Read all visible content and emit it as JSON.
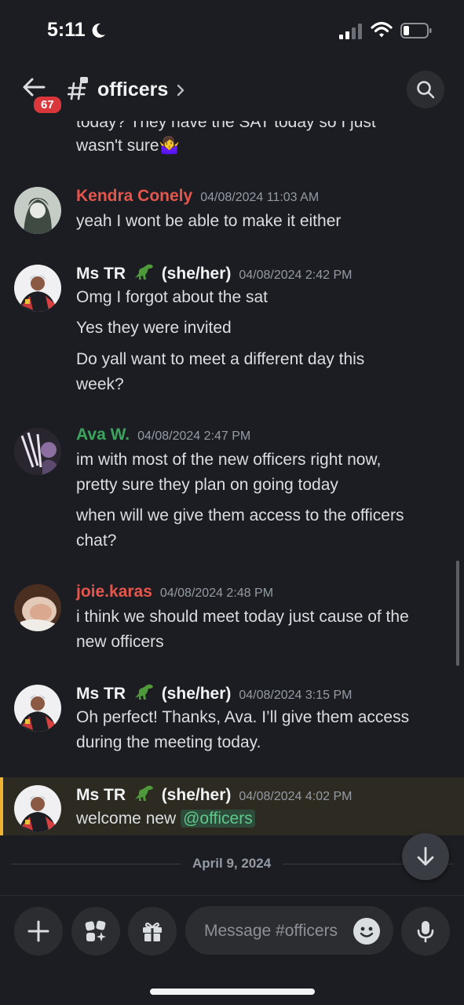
{
  "status": {
    "time": "5:11"
  },
  "header": {
    "badge": "67",
    "channel": "officers"
  },
  "messages": [
    {
      "lines": [
        "today? They have the SAT today so I just",
        "wasn't sure🤷‍♀️"
      ]
    },
    {
      "user": "Kendra Conely",
      "color": "#e5564c",
      "timestamp": "04/08/2024 11:03 AM",
      "lines": [
        "yeah I wont be able to make it either"
      ]
    },
    {
      "user": "Ms TR",
      "pronouns": "(she/her)",
      "color": "#f2f3f5",
      "timestamp": "04/08/2024 2:42 PM",
      "lines": [
        "Omg I forgot about the sat",
        "Yes they were invited",
        "Do yall want to meet a different day this",
        "week?"
      ]
    },
    {
      "user": "Ava W.",
      "color": "#3ba55d",
      "timestamp": "04/08/2024 2:47 PM",
      "lines": [
        "im with most of the new officers right now,",
        "pretty sure they plan on going today",
        "when will we give them access to the officers",
        "chat?"
      ]
    },
    {
      "user": "joie.karas",
      "color": "#e5564c",
      "timestamp": "04/08/2024 2:48 PM",
      "lines": [
        "i think we should meet today just cause of the",
        "new officers"
      ]
    },
    {
      "user": "Ms TR",
      "pronouns": "(she/her)",
      "color": "#f2f3f5",
      "timestamp": "04/08/2024 3:15 PM",
      "lines": [
        "Oh perfect! Thanks, Ava. I’ll give them access",
        "during the meeting today."
      ]
    },
    {
      "user": "Ms TR",
      "pronouns": "(she/her)",
      "color": "#f2f3f5",
      "timestamp": "04/08/2024 4:02 PM",
      "text": "welcome new",
      "mention": "@officers"
    }
  ],
  "divider": {
    "date": "April 9, 2024"
  },
  "composer": {
    "placeholder": "Message #officers"
  },
  "colors": {
    "background": "#1c1d22",
    "mention_bg": "#2e4a3a",
    "mention_text": "#5ec98a",
    "highlight_bar": "#f0b232",
    "badge": "#da373c"
  }
}
